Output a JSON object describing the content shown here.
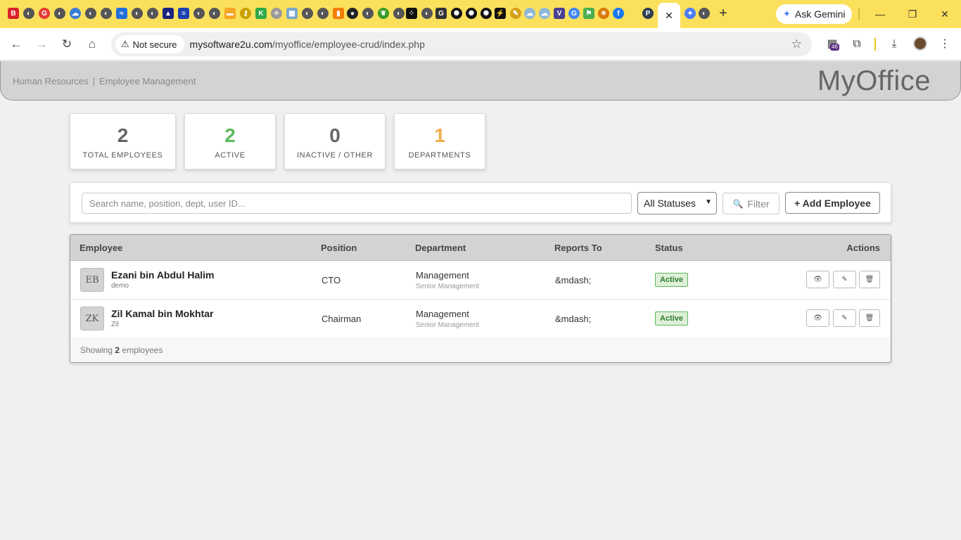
{
  "browser": {
    "tab_close_glyph": "✕",
    "new_tab_glyph": "+",
    "ask_gemini_label": "Ask Gemini",
    "security_label": "Not secure",
    "url_host": "mysoftware2u.com",
    "url_path": "/myoffice/employee-crud/index.php",
    "extension_badge": "46",
    "window_minimize": "—",
    "window_restore": "❐",
    "window_close": "✕"
  },
  "header": {
    "breadcrumb_section": "Human Resources",
    "breadcrumb_separator": "|",
    "breadcrumb_page": "Employee Management",
    "brand": "MyOffice"
  },
  "stats": [
    {
      "value": "2",
      "label": "TOTAL EMPLOYEES",
      "color": "#666666"
    },
    {
      "value": "2",
      "label": "ACTIVE",
      "color": "#5cb85c"
    },
    {
      "value": "0",
      "label": "INACTIVE / OTHER",
      "color": "#666666"
    },
    {
      "value": "1",
      "label": "DEPARTMENTS",
      "color": "#f0ad4e"
    }
  ],
  "filters": {
    "search_placeholder": "Search name, position, dept, user ID...",
    "status_selected": "All Statuses",
    "filter_label": "Filter",
    "add_label": "+ Add Employee"
  },
  "table": {
    "headers": {
      "employee": "Employee",
      "position": "Position",
      "department": "Department",
      "reports_to": "Reports To",
      "status": "Status",
      "actions": "Actions"
    },
    "rows": [
      {
        "initials": "EB",
        "name": "Ezani bin Abdul Halim",
        "user": "demo",
        "position": "CTO",
        "department": "Management",
        "department_sub": "Senior Management",
        "reports_to": "&mdash;",
        "status": "Active"
      },
      {
        "initials": "ZK",
        "name": "Zil Kamal bin Mokhtar",
        "user": "Zil",
        "position": "Chairman",
        "department": "Management",
        "department_sub": "Senior Management",
        "reports_to": "&mdash;",
        "status": "Active"
      }
    ],
    "footer_prefix": "Showing",
    "footer_count": "2",
    "footer_suffix": "employees"
  }
}
